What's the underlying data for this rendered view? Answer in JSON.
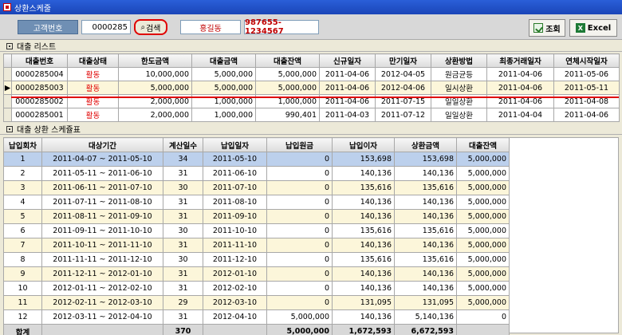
{
  "window": {
    "title": "상환스케줄"
  },
  "search": {
    "customer_label": "고객번호",
    "customer_value": "0000285",
    "search_button": "검색",
    "customer_name": "홍길동",
    "phone": "987655-1234567"
  },
  "toolbar": {
    "query_label": "조회",
    "excel_label": "Excel"
  },
  "loan_section": {
    "title": "대출 리스트"
  },
  "loan_table": {
    "headers": [
      "대출번호",
      "대출상태",
      "한도금액",
      "대출금액",
      "대출잔액",
      "신규일자",
      "만기일자",
      "상환방법",
      "최종거래일자",
      "연체시작일자"
    ],
    "rows": [
      [
        "0000285004",
        "활동",
        "10,000,000",
        "5,000,000",
        "5,000,000",
        "2011-04-06",
        "2012-04-05",
        "원금균등",
        "2011-04-06",
        "2011-05-06"
      ],
      [
        "0000285003",
        "활동",
        "5,000,000",
        "5,000,000",
        "5,000,000",
        "2011-04-06",
        "2012-04-06",
        "일시상환",
        "2011-04-06",
        "2011-05-11"
      ],
      [
        "0000285002",
        "활동",
        "2,000,000",
        "1,000,000",
        "1,000,000",
        "2011-04-06",
        "2011-07-15",
        "일일상환",
        "2011-04-06",
        "2011-04-08"
      ],
      [
        "0000285001",
        "활동",
        "2,000,000",
        "1,000,000",
        "990,401",
        "2011-04-03",
        "2011-07-12",
        "일일상환",
        "2011-04-04",
        "2011-04-06"
      ]
    ],
    "selected_row": 1
  },
  "schedule_section": {
    "title": "대출 상환 스케쥴표"
  },
  "schedule_table": {
    "headers": [
      "납입회차",
      "대상기간",
      "계산일수",
      "납입일자",
      "납입원금",
      "납입이자",
      "상환금액",
      "대출잔액"
    ],
    "rows": [
      [
        "1",
        "2011-04-07 ~ 2011-05-10",
        "34",
        "2011-05-10",
        "0",
        "153,698",
        "153,698",
        "5,000,000"
      ],
      [
        "2",
        "2011-05-11 ~ 2011-06-10",
        "31",
        "2011-06-10",
        "0",
        "140,136",
        "140,136",
        "5,000,000"
      ],
      [
        "3",
        "2011-06-11 ~ 2011-07-10",
        "30",
        "2011-07-10",
        "0",
        "135,616",
        "135,616",
        "5,000,000"
      ],
      [
        "4",
        "2011-07-11 ~ 2011-08-10",
        "31",
        "2011-08-10",
        "0",
        "140,136",
        "140,136",
        "5,000,000"
      ],
      [
        "5",
        "2011-08-11 ~ 2011-09-10",
        "31",
        "2011-09-10",
        "0",
        "140,136",
        "140,136",
        "5,000,000"
      ],
      [
        "6",
        "2011-09-11 ~ 2011-10-10",
        "30",
        "2011-10-10",
        "0",
        "135,616",
        "135,616",
        "5,000,000"
      ],
      [
        "7",
        "2011-10-11 ~ 2011-11-10",
        "31",
        "2011-11-10",
        "0",
        "140,136",
        "140,136",
        "5,000,000"
      ],
      [
        "8",
        "2011-11-11 ~ 2011-12-10",
        "30",
        "2011-12-10",
        "0",
        "135,616",
        "135,616",
        "5,000,000"
      ],
      [
        "9",
        "2011-12-11 ~ 2012-01-10",
        "31",
        "2012-01-10",
        "0",
        "140,136",
        "140,136",
        "5,000,000"
      ],
      [
        "10",
        "2012-01-11 ~ 2012-02-10",
        "31",
        "2012-02-10",
        "0",
        "140,136",
        "140,136",
        "5,000,000"
      ],
      [
        "11",
        "2012-02-11 ~ 2012-03-10",
        "29",
        "2012-03-10",
        "0",
        "131,095",
        "131,095",
        "5,000,000"
      ],
      [
        "12",
        "2012-03-11 ~ 2012-04-10",
        "31",
        "2012-04-10",
        "5,000,000",
        "140,136",
        "5,140,136",
        "0"
      ]
    ],
    "total": [
      "합계",
      "",
      "370",
      "",
      "5,000,000",
      "1,672,593",
      "6,672,593",
      ""
    ]
  }
}
